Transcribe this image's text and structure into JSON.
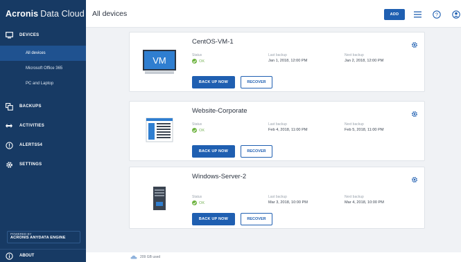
{
  "brand": {
    "name_bold": "Acronis",
    "name_light": "Data Cloud"
  },
  "sidebar": {
    "sections": [
      {
        "label": "DEVICES",
        "icon": "devices-icon"
      },
      {
        "label": "BACKUPS",
        "icon": "backups-icon"
      },
      {
        "label": "ACTIVITIES",
        "icon": "activities-icon"
      },
      {
        "label": "ALERTS",
        "badge": "54",
        "icon": "alerts-icon"
      },
      {
        "label": "SETTINGS",
        "icon": "settings-icon"
      }
    ],
    "device_items": [
      {
        "label": "All devices",
        "active": true
      },
      {
        "label": "Microsoft Office 365"
      },
      {
        "label": "PC and Laptop"
      }
    ],
    "powered_by": {
      "line1": "POWERED BY",
      "line2": "ACRONIS ANYDATA ENGINE"
    },
    "about": {
      "label": "ABOUT",
      "icon": "info-icon"
    }
  },
  "header": {
    "title": "All devices",
    "add_label": "ADD",
    "icons": [
      "list-view-icon",
      "help-icon",
      "account-icon"
    ]
  },
  "devices": [
    {
      "name": "CentOS-VM-1",
      "thumb": "vm",
      "thumb_text": "VM",
      "status_label": "Status",
      "status": "OK",
      "last_label": "Last backup",
      "last": "Jan 1, 2018, 12:00 PM",
      "next_label": "Next backup",
      "next": "Jan 2, 2018, 12:00 PM",
      "primary": "BACK UP NOW",
      "secondary": "RECOVER"
    },
    {
      "name": "Website-Corporate",
      "thumb": "website",
      "status_label": "Status",
      "status": "OK",
      "last_label": "Last backup",
      "last": "Feb 4, 2018, 11:00 PM",
      "next_label": "Next backup",
      "next": "Feb 5, 2018, 11:00 PM",
      "primary": "BACK UP NOW",
      "secondary": "RECOVER"
    },
    {
      "name": "Windows-Server-2",
      "thumb": "server",
      "status_label": "Status",
      "status": "OK",
      "last_label": "Last backup",
      "last": "Mar 3, 2018, 10:00 PM",
      "next_label": "Next backup",
      "next": "Mar 4, 2018, 10:00 PM",
      "primary": "BACK UP NOW",
      "secondary": "RECOVER"
    }
  ],
  "footer": {
    "storage": "209 GB used"
  },
  "colors": {
    "sidebar": "#173a64",
    "active": "#1f5290",
    "accent": "#1f5fb1",
    "ok": "#6db33f"
  }
}
